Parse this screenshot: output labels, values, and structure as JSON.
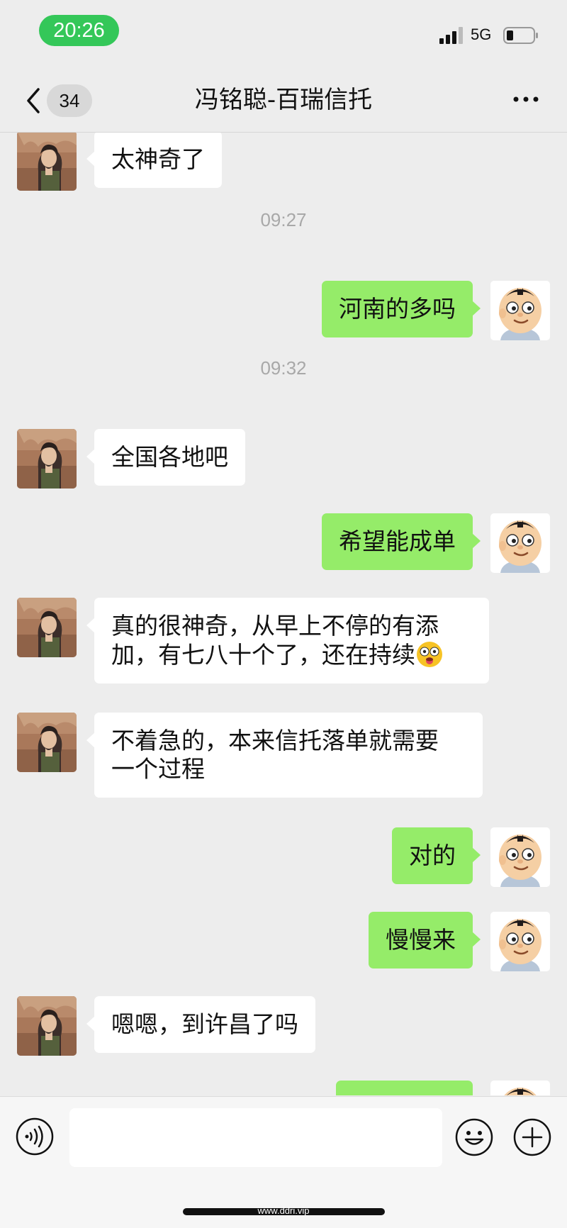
{
  "status_bar": {
    "time": "20:26",
    "network": "5G"
  },
  "nav": {
    "unread_count": "34",
    "title": "冯铭聪-百瑞信托"
  },
  "messages": [
    {
      "text": "太神奇了"
    },
    {
      "time": "09:27"
    },
    {
      "text": "河南的多吗"
    },
    {
      "time": "09:32"
    },
    {
      "text": "全国各地吧"
    },
    {
      "text": "希望能成单"
    },
    {
      "line1": "真的很神奇，从早上不停的有添",
      "line2": "加，有七八十个了，还在持续",
      "emoji": "dizzy-face-emoji"
    },
    {
      "line1": "不着急的，本来信托落单就需要",
      "line2": "一个过程"
    },
    {
      "text": "对的"
    },
    {
      "text": "慢慢来"
    },
    {
      "text": "嗯嗯，到许昌了吗"
    }
  ],
  "input": {
    "value": "",
    "placeholder": ""
  },
  "watermark": "www.ddri.vip",
  "colors": {
    "sent_bubble": "#95ec69",
    "received_bubble": "#ffffff",
    "background": "#ededed",
    "time_pill": "#34c759"
  }
}
